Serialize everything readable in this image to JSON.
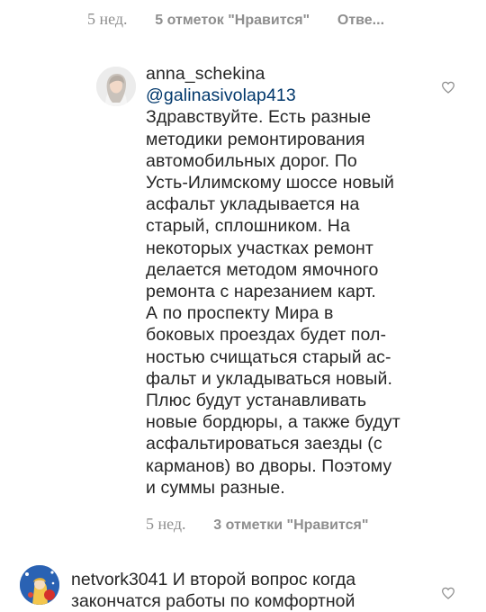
{
  "top_comment_meta": {
    "time": "5 нед.",
    "likes": "5 отметок \"Нравится\"",
    "reply": "Отве..."
  },
  "reply_comment": {
    "username": "anna_schekina",
    "mention": "@galinasivolap413",
    "text": "Здравствуйте. Есть разные\nметодики ремонтирования\nавтомобильных дорог. По\nУсть-Илимскому шоссе новый\nасфальт укладывается на\nстарый, сплошником. На\nнекоторых участках ремонт\nделается методом ямочного\nремонта с нарезанием карт.\nА по проспекту Мира в\nбоковых проездах будет пол-\nностью счищаться старый ас-\nфальт и укладываться новый.\nПлюс будут устанавливать\nновые бордюры, а также будут\nасфальтироваться заезды (с\nкарманов) во дворы. Поэтому\nи суммы разные.",
    "time": "5 нед.",
    "likes": "3 отметки \"Нравится\"",
    "avatar_icon": "user-avatar-photo"
  },
  "next_comment": {
    "username": "netvork3041",
    "text": "И второй вопрос когда\nзакончатся работы по комфортной",
    "avatar_icon": "user-avatar-illustration"
  },
  "icons": {
    "like": "heart-outline-icon"
  },
  "colors": {
    "meta_gray": "#8e8e8e",
    "mention_blue": "#00376b",
    "text": "#262626"
  }
}
